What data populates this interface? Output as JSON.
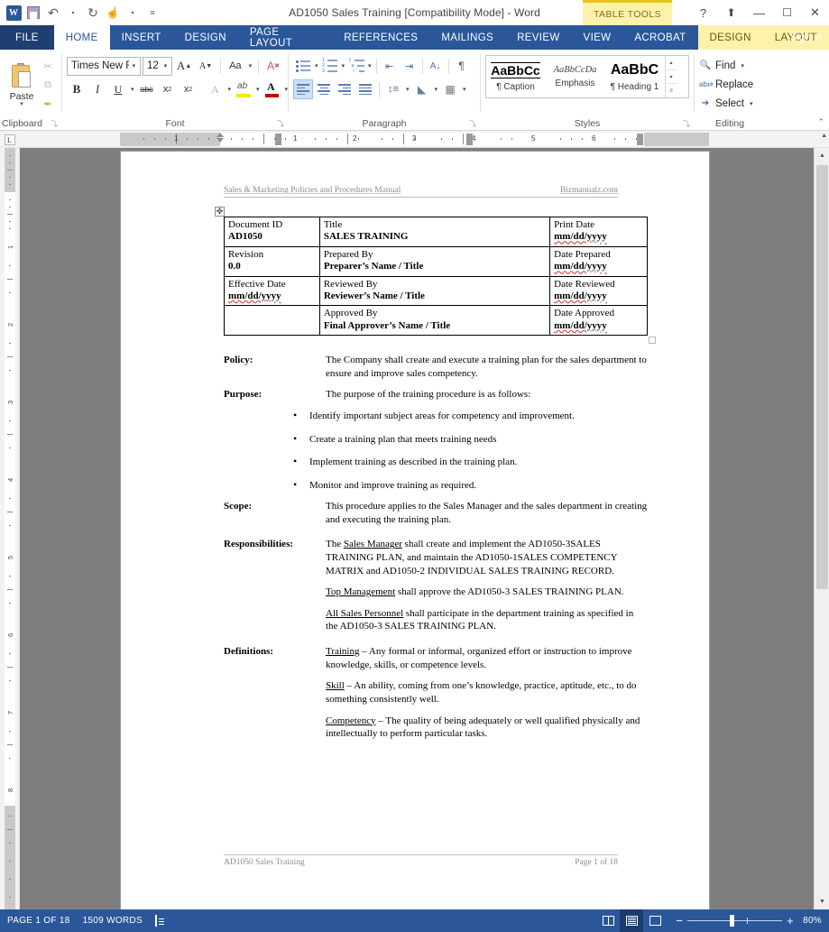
{
  "titlebar": {
    "app_logo": "word-logo",
    "quick_access": [
      {
        "name": "save-icon",
        "label": "Save"
      },
      {
        "name": "undo-icon",
        "label": "↶"
      },
      {
        "name": "redo-icon",
        "label": "↻"
      },
      {
        "name": "touch-mode-icon",
        "label": "☝"
      },
      {
        "name": "customize-qat-icon",
        "label": "≡"
      }
    ],
    "title": "AD1050 Sales Training [Compatibility Mode] - Word",
    "contextual_tab_group": "TABLE TOOLS",
    "help": "?",
    "ribbon_display": "⬆",
    "minimize": "—",
    "restore": "☐",
    "close": "✕"
  },
  "tabs": {
    "file": "FILE",
    "items": [
      {
        "label": "HOME",
        "active": true
      },
      {
        "label": "INSERT",
        "active": false
      },
      {
        "label": "DESIGN",
        "active": false
      },
      {
        "label": "PAGE LAYOUT",
        "active": false
      },
      {
        "label": "REFERENCES",
        "active": false
      },
      {
        "label": "MAILINGS",
        "active": false
      },
      {
        "label": "REVIEW",
        "active": false
      },
      {
        "label": "VIEW",
        "active": false
      },
      {
        "label": "ACROBAT",
        "active": false
      }
    ],
    "contextual": [
      {
        "label": "DESIGN"
      },
      {
        "label": "LAYOUT"
      }
    ],
    "signin": "Sign in"
  },
  "ribbon": {
    "clipboard": {
      "label": "Clipboard",
      "paste": "Paste",
      "paste_caret": "▾",
      "cut": "✂",
      "copy": "⧉",
      "format_painter": "✒",
      "launcher": "⤵"
    },
    "font": {
      "label": "Font",
      "font_name": "Times New Ro",
      "font_size": "12",
      "grow_font": "A",
      "shrink_font": "A",
      "change_case": "Aa",
      "clear_formatting": "A",
      "bold": "B",
      "italic": "I",
      "underline": "U",
      "strikethrough": "abc",
      "subscript": "x",
      "superscript": "x",
      "text_effects": "A",
      "highlight": "ab",
      "font_color": "A",
      "launcher": "⤵"
    },
    "paragraph": {
      "label": "Paragraph",
      "bullets": "bullets-icon",
      "numbering": "numbering-icon",
      "multilevel": "multilevel-list-icon",
      "decrease_indent": "⇤",
      "increase_indent": "⇥",
      "sort": "A↓",
      "show_marks": "¶",
      "align_left": "align-left-icon",
      "align_center": "align-center-icon",
      "align_right": "align-right-icon",
      "justify": "justify-icon",
      "line_spacing": "line-spacing-icon",
      "shading": "shading-icon",
      "borders": "borders-icon",
      "launcher": "⤵"
    },
    "styles": {
      "label": "Styles",
      "gallery": [
        {
          "preview": "AaBbCc",
          "name": "¶ Caption",
          "kind": "caption"
        },
        {
          "preview": "AaBbCcDa",
          "name": "Emphasis",
          "kind": "emph"
        },
        {
          "preview": "AaBbC",
          "name": "¶ Heading 1",
          "kind": "h1"
        }
      ],
      "scroll_up": "▴",
      "scroll_down": "▾",
      "more": "≡",
      "launcher": "⤵"
    },
    "editing": {
      "label": "Editing",
      "find": "Find",
      "find_caret": "▾",
      "replace": "Replace",
      "select": "Select",
      "select_caret": "▾"
    },
    "collapse": "⌃"
  },
  "ruler": {
    "tab_selector": "L",
    "h_numbers": [
      "1",
      "1",
      "2",
      "3",
      "4",
      "5",
      "6"
    ],
    "v_numbers": [
      "1",
      "2",
      "3",
      "4",
      "5",
      "6",
      "7",
      "8"
    ]
  },
  "document": {
    "header": {
      "left": "Sales & Marketing Policies and Procedures Manual",
      "right": "Bizmanualz.com"
    },
    "table_handle": "✜",
    "info_table": [
      [
        {
          "label": "Document ID",
          "value": "AD1050"
        },
        {
          "label": "Title",
          "value": "SALES TRAINING"
        },
        {
          "label": "Print Date",
          "value": "mm/dd/yyyy"
        }
      ],
      [
        {
          "label": "Revision",
          "value": "0.0"
        },
        {
          "label": "Prepared By",
          "value": "Preparer’s Name / Title"
        },
        {
          "label": "Date Prepared",
          "value": "mm/dd/yyyy"
        }
      ],
      [
        {
          "label": "Effective Date",
          "value": "mm/dd/yyyy"
        },
        {
          "label": "Reviewed By",
          "value": "Reviewer’s Name / Title"
        },
        {
          "label": "Date Reviewed",
          "value": "mm/dd/yyyy"
        }
      ],
      [
        {
          "label": "",
          "value": ""
        },
        {
          "label": "Approved By",
          "value": "Final Approver’s Name / Title"
        },
        {
          "label": "Date Approved",
          "value": "mm/dd/yyyy"
        }
      ]
    ],
    "sections": {
      "policy_key": "Policy:",
      "policy_text": "The Company shall create and execute a training plan for the sales department to ensure and improve sales competency.",
      "purpose_key": "Purpose:",
      "purpose_text": "The purpose of the training procedure is as follows:",
      "purpose_bullets": [
        "Identify important subject areas for competency and improvement.",
        "Create a training plan that meets training needs",
        "Implement training as described in the training plan.",
        "Monitor and improve training as required."
      ],
      "scope_key": "Scope:",
      "scope_text": "This procedure applies to the Sales Manager and the sales department in creating and executing the training plan.",
      "resp_key": "Responsibilities:",
      "resp_p1_pre": "The ",
      "resp_p1_term": "Sales Manager",
      "resp_p1_post": " shall create and implement the AD1050-3SALES TRAINING PLAN, and maintain the AD1050-1SALES COMPETENCY MATRIX and AD1050-2 INDIVIDUAL SALES TRAINING RECORD.",
      "resp_p2_term": "Top Management",
      "resp_p2_post": " shall approve the AD1050-3 SALES TRAINING PLAN.",
      "resp_p3_term": "All Sales Personnel",
      "resp_p3_post": " shall participate in the department training as specified in the AD1050-3 SALES TRAINING PLAN.",
      "def_key": "Definitions:",
      "def_1_term": "Training",
      "def_1_text": " – Any formal or informal, organized effort or instruction to improve knowledge, skills, or competence levels.",
      "def_2_term": "Skill",
      "def_2_text": " – An ability, coming from one’s knowledge, practice, aptitude, etc., to do something consistently well.",
      "def_3_term": "Competency",
      "def_3_text": " – The quality of being adequately or well qualified physically and intellectually to perform particular tasks."
    },
    "footer": {
      "left": "AD1050 Sales Training",
      "right": "Page 1 of 18"
    }
  },
  "statusbar": {
    "page": "PAGE 1 OF 18",
    "words": "1509 WORDS",
    "proofing": "proofing-icon",
    "view_read": "read-mode-icon",
    "view_print": "print-layout-icon",
    "view_web": "web-layout-icon",
    "zoom_out": "−",
    "zoom_in": "+",
    "zoom_level": "80%"
  },
  "colors": {
    "accent": "#2b579a",
    "contextual": "#fdf2ac",
    "workspace": "#7e7e7e"
  }
}
